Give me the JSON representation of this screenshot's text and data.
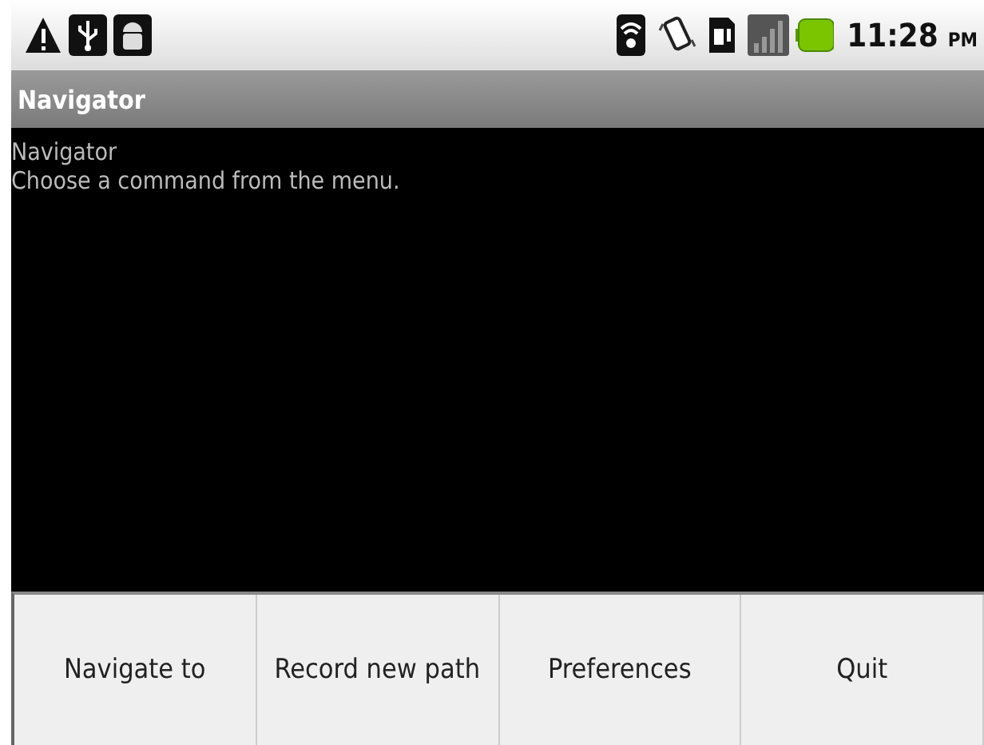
{
  "status_bar": {
    "time": "11:28",
    "meridiem": "PM"
  },
  "window": {
    "title": "Navigator"
  },
  "content": {
    "lines": [
      "Navigator",
      "Choose a command from the menu."
    ]
  },
  "menu": {
    "items": [
      {
        "label": "Navigate to"
      },
      {
        "label": "Record new path"
      },
      {
        "label": "Preferences"
      },
      {
        "label": "Quit"
      }
    ]
  }
}
